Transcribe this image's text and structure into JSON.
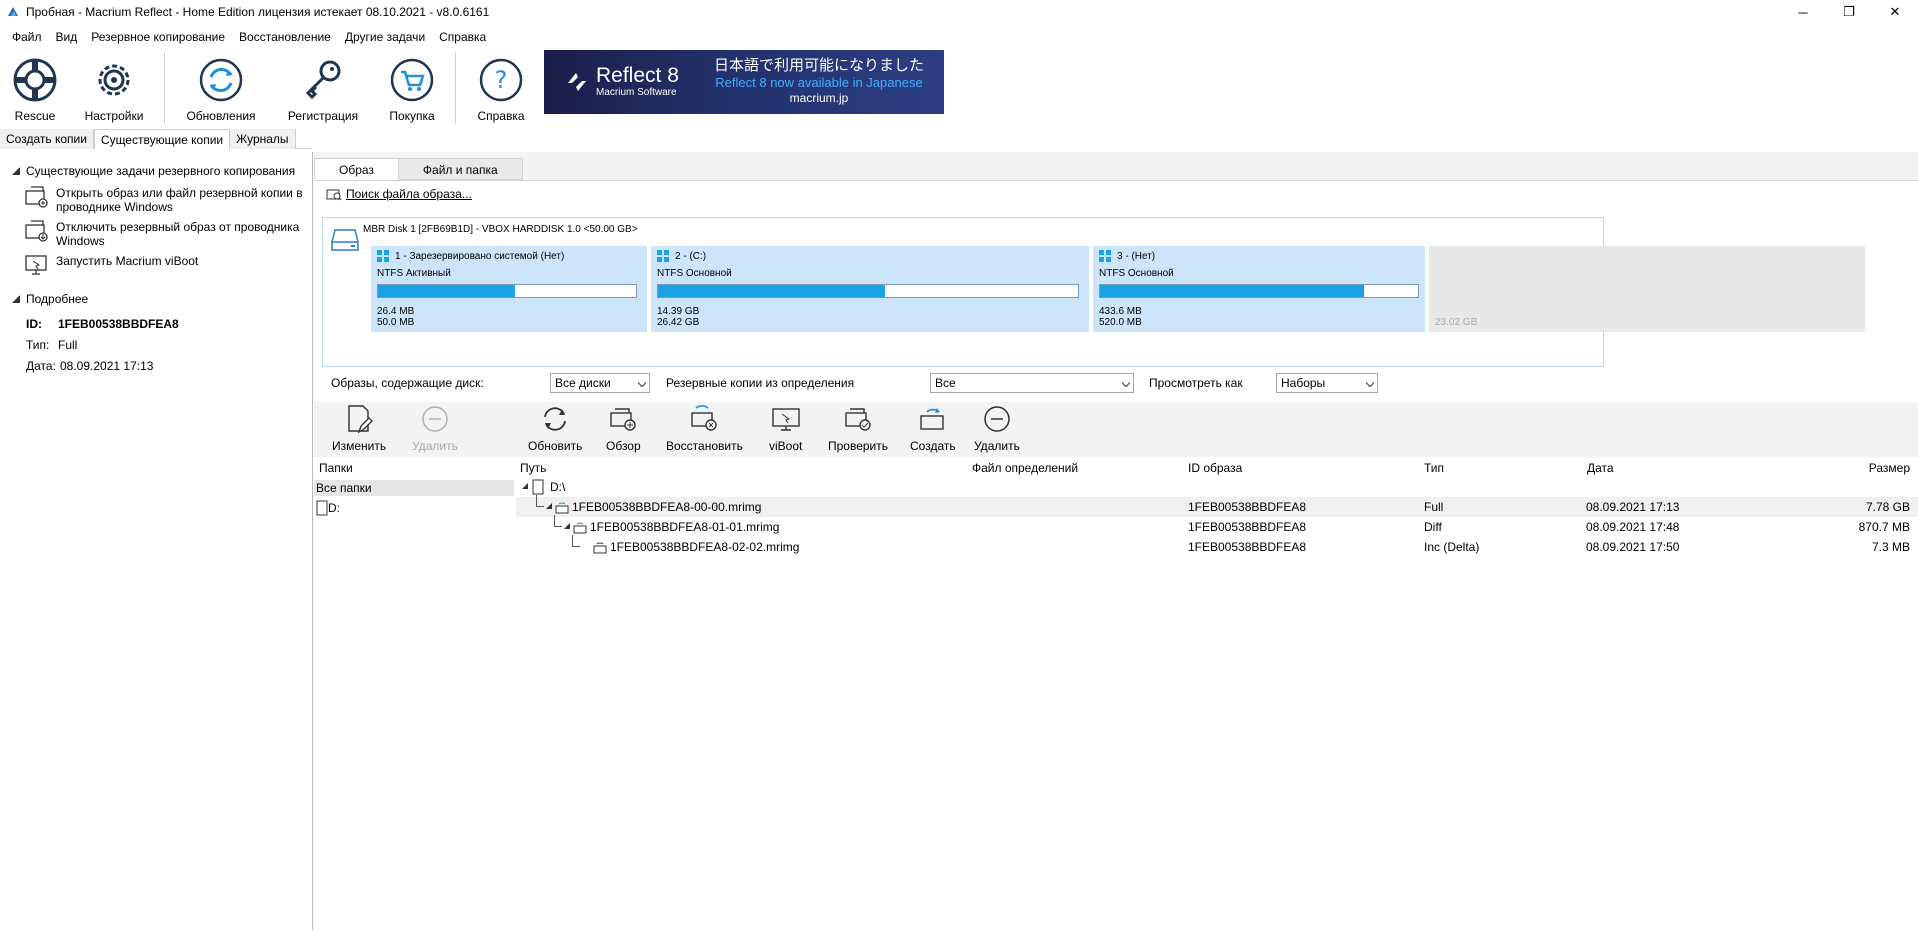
{
  "window": {
    "title": "Пробная - Macrium Reflect - Home Edition лицензия истекает 08.10.2021 - v8.0.6161",
    "minimize": "─",
    "restore": "❐",
    "close": "✕"
  },
  "menu": [
    "Файл",
    "Вид",
    "Резервное копирование",
    "Восстановление",
    "Другие задачи",
    "Справка"
  ],
  "toolbar": {
    "rescue": "Rescue",
    "settings": "Настройки",
    "updates": "Обновления",
    "registration": "Регистрация",
    "purchase": "Покупка",
    "help": "Справка"
  },
  "banner": {
    "brand": "Reflect 8",
    "brand_sub": "Macrium Software",
    "line_jp": "日本語で利用可能になりました",
    "line_en": "Reflect 8 now available in Japanese",
    "site": "macrium.jp"
  },
  "main_tabs": [
    "Создать копии",
    "Существующие копии",
    "Журналы"
  ],
  "left": {
    "tasks_header": "Существующие задачи резервного копирования",
    "tasks": [
      "Открыть образ или файл резервной копии в проводнике Windows",
      "Отключить резервный образ от проводника Windows",
      "Запустить Macrium viBoot"
    ],
    "details_header": "Подробнее",
    "details": {
      "id_label": "ID:",
      "id_value": "1FEB00538BBDFEA8",
      "type_label": "Тип:",
      "type_value": "Full",
      "date_label": "Дата:",
      "date_value": "08.09.2021 17:13"
    }
  },
  "sub_tabs": [
    "Образ",
    "Файл и папка"
  ],
  "search_link": "Поиск файла образа...",
  "disk": {
    "label": "MBR Disk 1 [2FB69B1D] - VBOX HARDDISK 1.0  <50.00 GB>",
    "partitions": [
      {
        "title": "1 - Зарезервировано системой (Нет)",
        "fs": "NTFS Активный",
        "used": "26.4 MB",
        "total": "50.0 MB",
        "fill": 0.53
      },
      {
        "title": "2 -  (C:)",
        "fs": "NTFS Основной",
        "used": "14.39 GB",
        "total": "26.42 GB",
        "fill": 0.54
      },
      {
        "title": "3 -  (Нет)",
        "fs": "NTFS Основной",
        "used": "433.6 MB",
        "total": "520.0 MB",
        "fill": 0.83
      }
    ],
    "unallocated": "23.02 GB"
  },
  "filters": {
    "images_label": "Образы, содержащие диск:",
    "images_value": "Все диски",
    "def_label": "Резервные копии из определения",
    "def_value": "Все",
    "view_label": "Просмотреть как",
    "view_value": "Наборы"
  },
  "actions": {
    "edit": "Изменить",
    "delete_disabled": "Удалить",
    "refresh": "Обновить",
    "browse": "Обзор",
    "restore": "Восстановить",
    "viboot": "viBoot",
    "verify": "Проверить",
    "create": "Создать",
    "delete": "Удалить"
  },
  "columns": {
    "folders": "Папки",
    "path": "Путь",
    "def_file": "Файл определений",
    "image_id": "ID образа",
    "type": "Тип",
    "date": "Дата",
    "size": "Размер"
  },
  "folders": {
    "all": "Все папки",
    "drive": "D:"
  },
  "tree": {
    "root": "D:\\",
    "rows": [
      {
        "name": "1FEB00538BBDFEA8-00-00.mrimg",
        "id": "1FEB00538BBDFEA8",
        "type": "Full",
        "date": "08.09.2021 17:13",
        "size": "7.78 GB"
      },
      {
        "name": "1FEB00538BBDFEA8-01-01.mrimg",
        "id": "1FEB00538BBDFEA8",
        "type": "Diff",
        "date": "08.09.2021 17:48",
        "size": "870.7 MB"
      },
      {
        "name": "1FEB00538BBDFEA8-02-02.mrimg",
        "id": "1FEB00538BBDFEA8",
        "type": "Inc (Delta)",
        "date": "08.09.2021 17:50",
        "size": "7.3 MB"
      }
    ]
  },
  "colors": {
    "accent": "#19a2e6",
    "partition_bg": "#cce5fb",
    "banner_bg": "#1a1f4a",
    "banner_link": "#3fb1ff"
  }
}
